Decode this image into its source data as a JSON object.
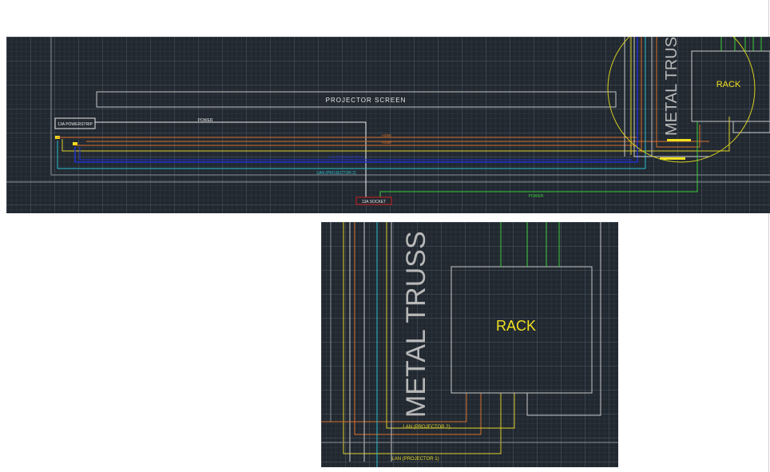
{
  "overview": {
    "projector_screen": "PROJECTOR SCREEN",
    "power_strip": "13A POWERSTRIP",
    "power_top": "POWER",
    "hdmi_1": "HDMI",
    "hdmi_2": "HDMI",
    "lan_projector_1": "LAN (PROJECTOR 1)",
    "lan_projector_2": "LAN (PROJECTOR 2)",
    "socket": "13A SOCKET",
    "power_bottom": "POWER",
    "truss": "METAL TRUSS",
    "rack": "RACK"
  },
  "detail": {
    "truss": "METAL TRUSS",
    "rack": "RACK",
    "lan_projector_2": "LAN (PROJECTOR 2)",
    "lan_projector_1": "LAN (PROJECTOR 1)"
  },
  "colors": {
    "background": "#212830",
    "hdmi": "#d9702a",
    "lan_1": "#e0d12a",
    "lan_2": "#2ac0d0",
    "lan_blue": "#2030d0",
    "power_green": "#3acc3a",
    "socket_red": "#d02020",
    "rack_text": "#f0e020",
    "truss_text": "#b8b8b8"
  }
}
